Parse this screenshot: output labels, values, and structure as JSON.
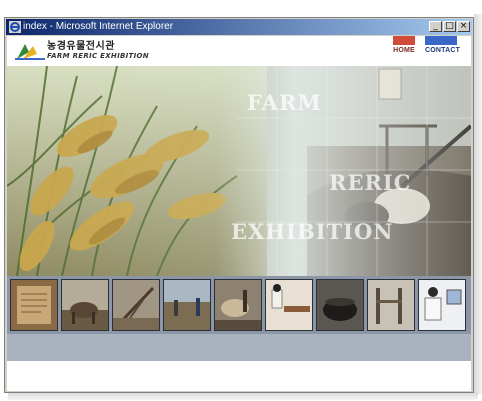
{
  "window": {
    "title": "index - Microsoft Internet Explorer",
    "buttons": {
      "minimize": "_",
      "maximize": "□",
      "close": "×"
    }
  },
  "site": {
    "logo_korean": "농경유물전시관",
    "logo_english": "FARM RERIC EXHIBITION",
    "nav": [
      {
        "label": "HOME",
        "color": "#d24b3b"
      },
      {
        "label": "CONTACT",
        "color": "#3a67c8"
      }
    ]
  },
  "hero": {
    "words": [
      "FARM",
      "RERIC",
      "EXHIBITION"
    ],
    "image": "rice-field-and-farm-tools-collage"
  },
  "thumbnails": [
    {
      "name": "thumb-document",
      "icon": "old-document-icon",
      "color": "#b08a5a"
    },
    {
      "name": "thumb-cattle",
      "icon": "cattle-icon",
      "color": "#7a6a52"
    },
    {
      "name": "thumb-tools",
      "icon": "farm-tool-icon",
      "color": "#8a7a64"
    },
    {
      "name": "thumb-field",
      "icon": "field-people-icon",
      "color": "#7c8a6a"
    },
    {
      "name": "thumb-ox-plow",
      "icon": "ox-plow-icon",
      "color": "#6e6252"
    },
    {
      "name": "thumb-weaving",
      "icon": "weaving-icon",
      "color": "#b9a68a"
    },
    {
      "name": "thumb-pot",
      "icon": "cooking-pot-icon",
      "color": "#3d3a36"
    },
    {
      "name": "thumb-loom",
      "icon": "loom-icon",
      "color": "#a8a092"
    },
    {
      "name": "thumb-computer",
      "icon": "computer-user-icon",
      "color": "#d8dce2"
    }
  ]
}
